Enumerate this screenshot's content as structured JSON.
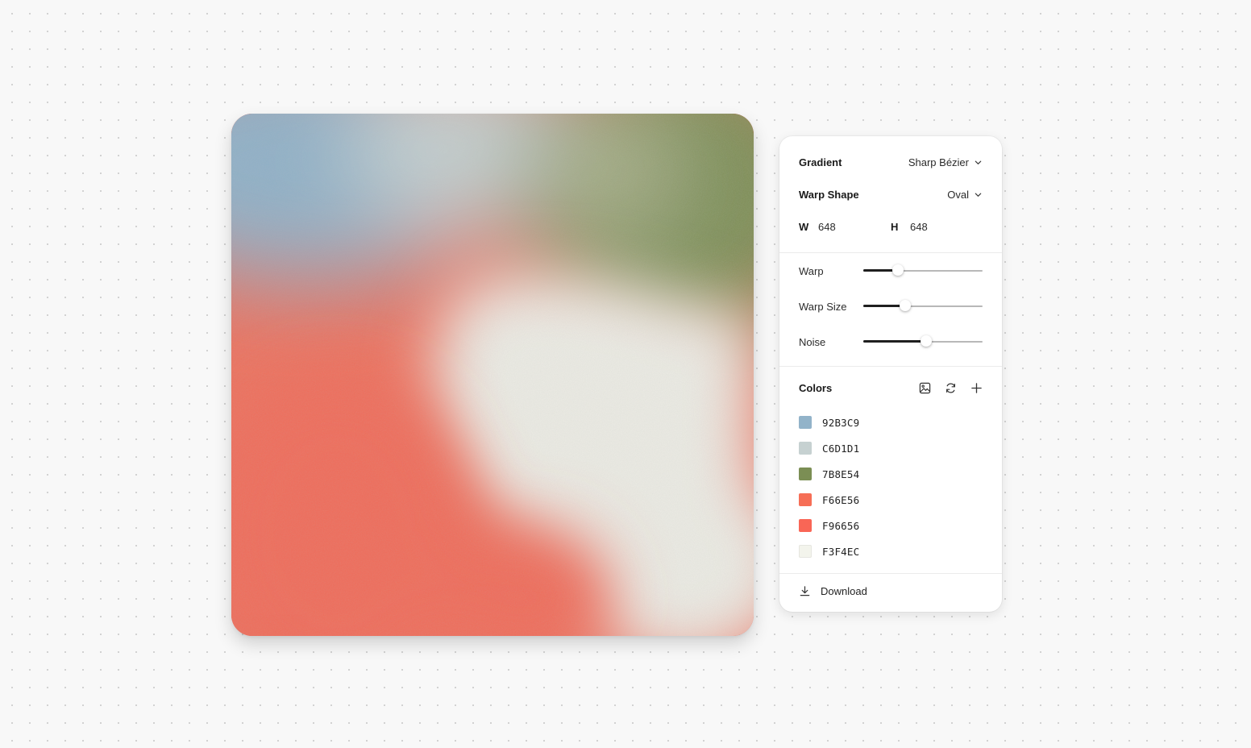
{
  "canvas": {
    "colors": [
      "#92B3C9",
      "#C6D1D1",
      "#7B8E54",
      "#F66E56",
      "#F96656",
      "#F3F4EC"
    ]
  },
  "panel": {
    "gradient": {
      "label": "Gradient",
      "value": "Sharp Bézier"
    },
    "warp_shape": {
      "label": "Warp Shape",
      "value": "Oval"
    },
    "dimensions": {
      "w_label": "W",
      "w_value": "648",
      "h_label": "H",
      "h_value": "648"
    },
    "sliders": [
      {
        "label": "Warp",
        "value": 0.29
      },
      {
        "label": "Warp Size",
        "value": 0.35
      },
      {
        "label": "Noise",
        "value": 0.53
      }
    ],
    "colors": {
      "title": "Colors",
      "icons": [
        "image-icon",
        "refresh-icon",
        "plus-icon"
      ],
      "items": [
        {
          "hex": "92B3C9",
          "color": "#92B3C9"
        },
        {
          "hex": "C6D1D1",
          "color": "#C6D1D1"
        },
        {
          "hex": "7B8E54",
          "color": "#7B8E54"
        },
        {
          "hex": "F66E56",
          "color": "#F66E56"
        },
        {
          "hex": "F96656",
          "color": "#F96656"
        },
        {
          "hex": "F3F4EC",
          "color": "#F3F4EC"
        }
      ]
    },
    "download": {
      "label": "Download",
      "icon": "download-icon"
    }
  }
}
